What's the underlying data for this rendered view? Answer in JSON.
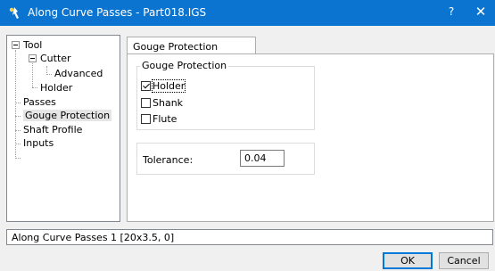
{
  "window": {
    "title": "Along Curve Passes - Part018.IGS",
    "help_label": "?",
    "close_label": "✕"
  },
  "tree": {
    "items": [
      {
        "label": "Tool"
      },
      {
        "label": "Cutter"
      },
      {
        "label": "Advanced"
      },
      {
        "label": "Holder"
      },
      {
        "label": "Passes"
      },
      {
        "label": "Gouge Protection",
        "selected": true
      },
      {
        "label": "Shaft Profile"
      },
      {
        "label": "Inputs"
      }
    ]
  },
  "tab": {
    "label": "Gouge Protection"
  },
  "gouge_group": {
    "title": "Gouge Protection",
    "options": [
      {
        "label": "Holder",
        "checked": true
      },
      {
        "label": "Shank",
        "checked": false
      },
      {
        "label": "Flute",
        "checked": false
      }
    ]
  },
  "tolerance": {
    "label": "Tolerance:",
    "value": "0.04"
  },
  "status": {
    "text": "Along Curve Passes 1 [20x3.5, 0]"
  },
  "buttons": {
    "ok": "OK",
    "cancel": "Cancel"
  },
  "colors": {
    "titlebar": "#0a74d0",
    "default_button_border": "#0078d7"
  }
}
